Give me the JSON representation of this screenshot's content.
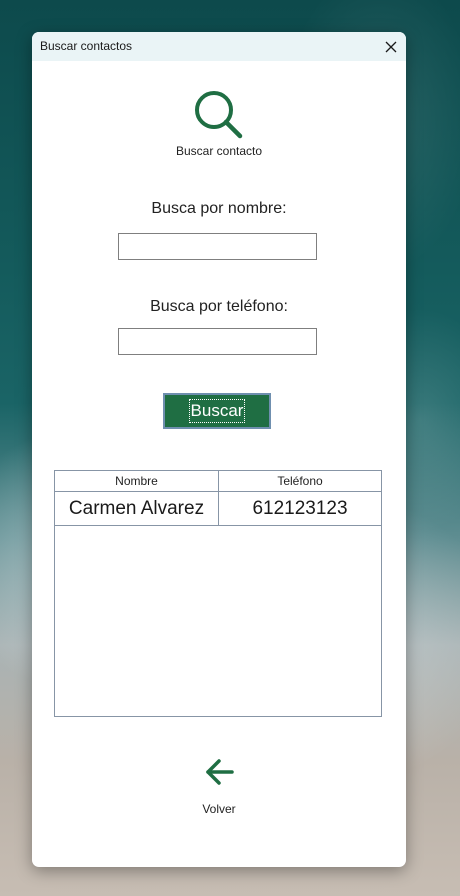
{
  "window": {
    "title": "Buscar contactos",
    "close_icon": "close-icon"
  },
  "header": {
    "icon": "search-icon",
    "caption": "Buscar contacto",
    "accent_color": "#1f6e43"
  },
  "form": {
    "name_label": "Busca por nombre:",
    "name_value": "",
    "phone_label": "Busca por teléfono:",
    "phone_value": "",
    "search_button_label": "Buscar"
  },
  "results": {
    "columns": [
      "Nombre",
      "Teléfono"
    ],
    "rows": [
      [
        "Carmen Alvarez",
        "612123123"
      ]
    ]
  },
  "footer": {
    "back_icon": "arrow-left-icon",
    "back_label": "Volver"
  }
}
